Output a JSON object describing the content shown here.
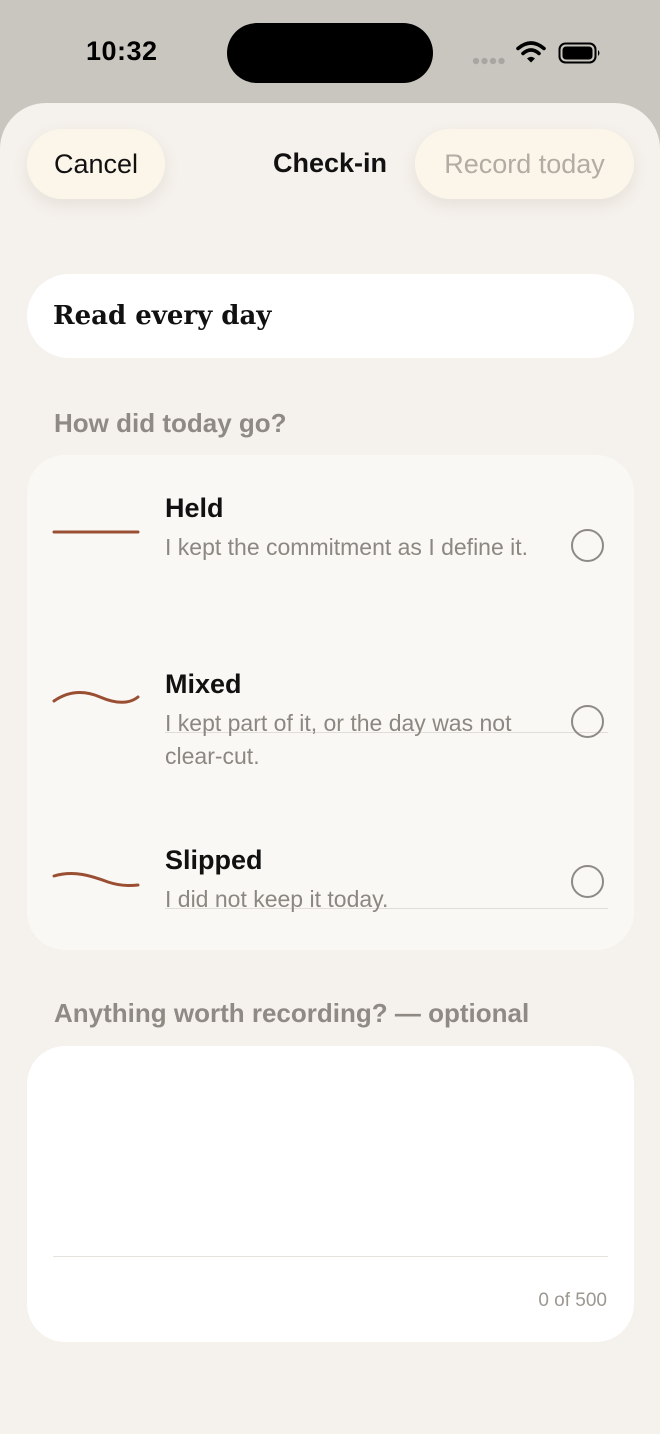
{
  "status_bar": {
    "time": "10:32",
    "icons": [
      "signal-icon",
      "wifi-icon",
      "battery-icon"
    ]
  },
  "header": {
    "cancel_label": "Cancel",
    "title": "Check-in",
    "record_label": "Record today"
  },
  "commitment": {
    "name": "Read every day"
  },
  "question": {
    "label": "How did today go?",
    "options": [
      {
        "name": "Held",
        "description": "I kept the commitment as I define it.",
        "selected": false,
        "icon": "flat-line-icon"
      },
      {
        "name": "Mixed",
        "description": "I kept part of it, or the day was not clear-cut.",
        "selected": false,
        "icon": "wave-line-icon"
      },
      {
        "name": "Slipped",
        "description": "I did not keep it today.",
        "selected": false,
        "icon": "down-curve-icon"
      }
    ]
  },
  "note": {
    "label": "Anything worth recording? — optional",
    "value": "",
    "counter": "0 of 500"
  },
  "colors": {
    "accent": "#9a4f33",
    "sheet_background": "#f5f1ec",
    "pill_background": "#fcf6ea",
    "muted_text": "#8f8a84"
  }
}
